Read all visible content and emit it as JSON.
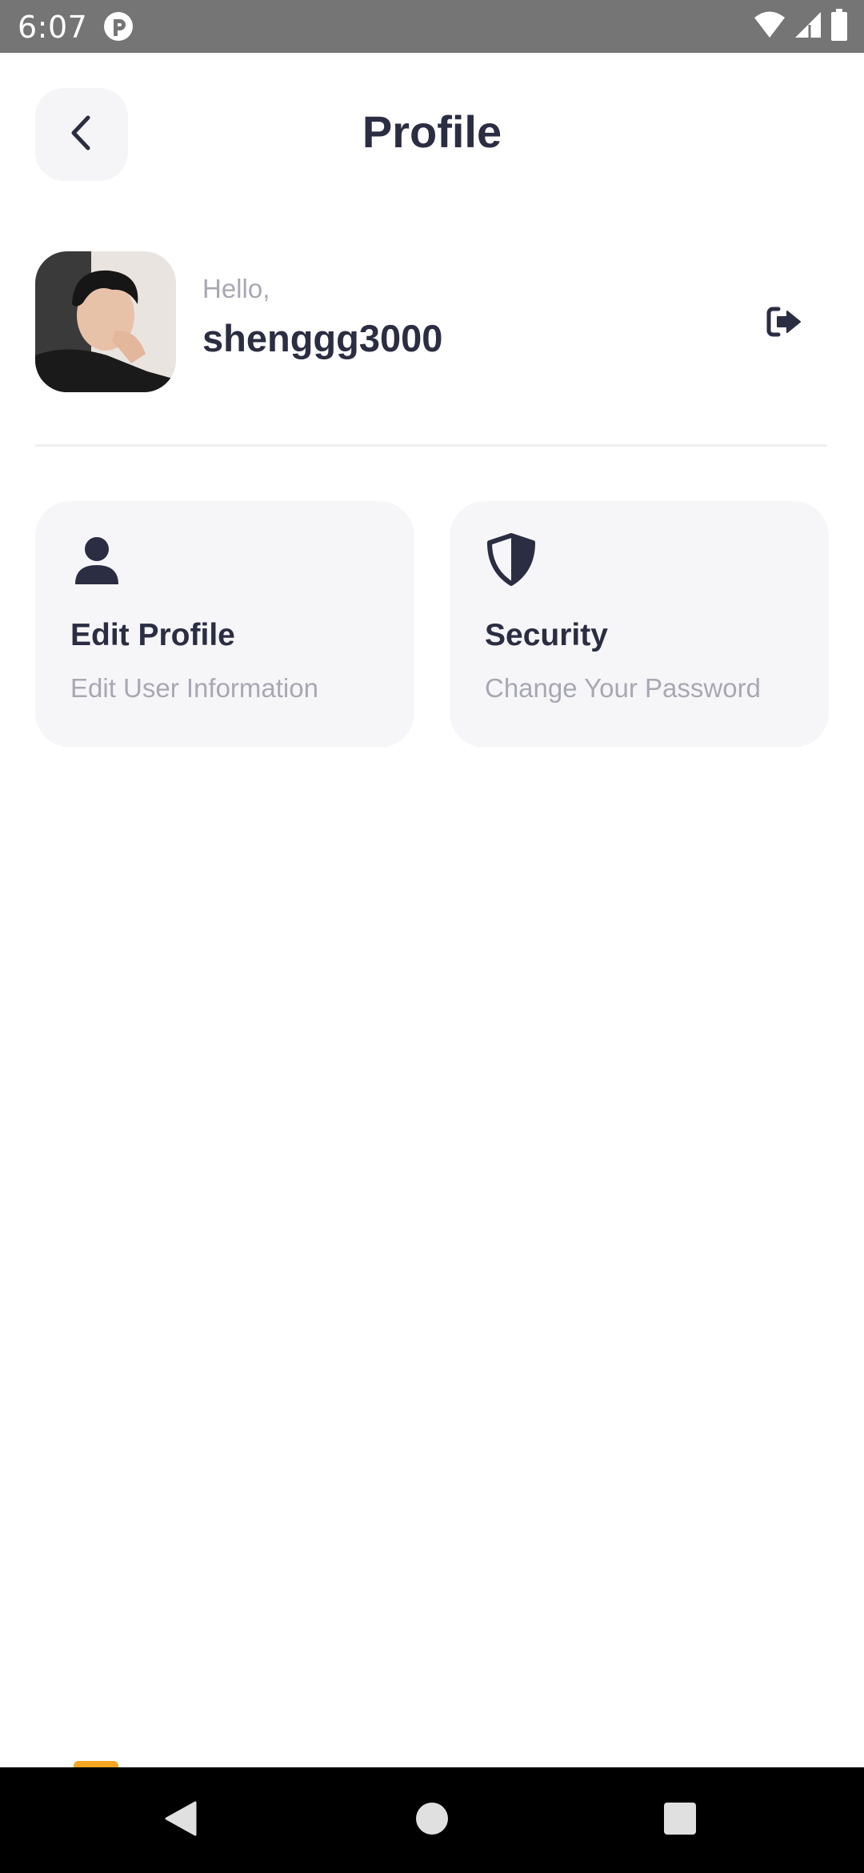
{
  "status_bar": {
    "time": "6:07",
    "icons": [
      "app-notification-icon",
      "wifi-icon",
      "cellular-signal-icon",
      "battery-icon"
    ]
  },
  "header": {
    "title": "Profile",
    "back_icon": "chevron-left-icon"
  },
  "user": {
    "greeting": "Hello,",
    "username": "shenggg3000",
    "logout_icon": "logout-icon"
  },
  "cards": [
    {
      "title": "Edit Profile",
      "subtitle": "Edit User Information",
      "icon": "user-icon"
    },
    {
      "title": "Security",
      "subtitle": "Change Your Password",
      "icon": "shield-icon"
    }
  ],
  "colors": {
    "text_primary": "#2b2d42",
    "text_secondary": "#a8a8b3",
    "card_background": "#f6f6f9",
    "accent_orange": "#f5a623",
    "status_bar": "#757575"
  },
  "nav_bar": {
    "buttons": [
      "back-triangle-icon",
      "home-circle-icon",
      "recents-square-icon"
    ]
  }
}
